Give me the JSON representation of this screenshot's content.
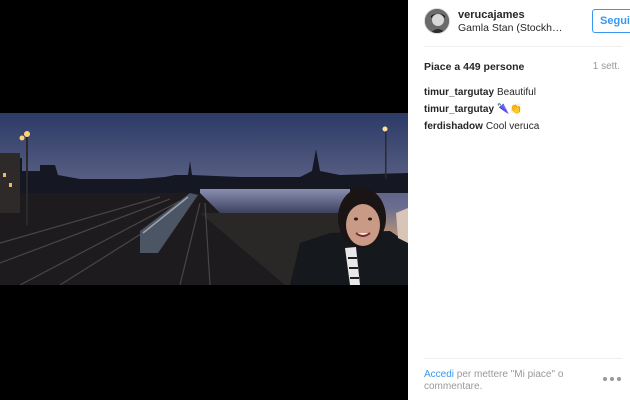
{
  "post": {
    "username": "verucajames",
    "location": "Gamla Stan (Stockholm)",
    "follow_label": "Segui",
    "likes": "Piace a 449 persone",
    "time": "1 sett."
  },
  "comments": [
    {
      "user": "timur_targutay",
      "text": "Beautiful"
    },
    {
      "user": "timur_targutay",
      "text": "🌂👏"
    },
    {
      "user": "ferdishadow",
      "text": "Cool veruca"
    }
  ],
  "footer": {
    "login_link": "Accedi",
    "login_text": " per mettere \"Mi piace\" o commentare."
  },
  "icons": {
    "avatar": "avatar-icon",
    "more": "more-options-icon"
  }
}
